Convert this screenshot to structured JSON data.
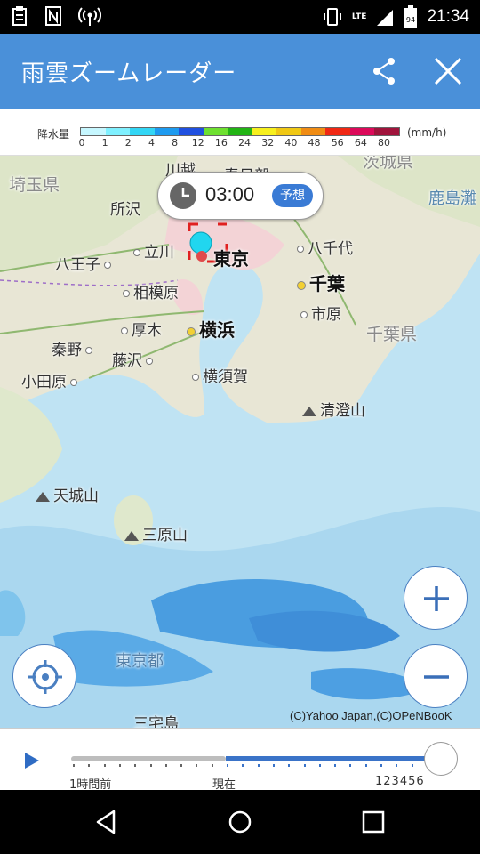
{
  "status_bar": {
    "time": "21:34",
    "network": "LTE",
    "battery": "94"
  },
  "app_bar": {
    "title": "雨雲ズームレーダー",
    "share_icon": "share-icon",
    "close_icon": "close-icon"
  },
  "legend": {
    "title": "降水量",
    "unit": "(mm/h)",
    "stops": [
      "0",
      "1",
      "2",
      "4",
      "8",
      "12",
      "16",
      "24",
      "32",
      "40",
      "48",
      "56",
      "64",
      "80"
    ],
    "colors": [
      "#c6f7ff",
      "#7ff0ff",
      "#33d6f5",
      "#1e9bf0",
      "#2050e0",
      "#6ee030",
      "#22b414",
      "#f7f01e",
      "#f0c814",
      "#f08c14",
      "#f02814",
      "#dc0a5a",
      "#a0143c"
    ]
  },
  "time_chip": {
    "time": "03:00",
    "badge": "予想"
  },
  "map": {
    "places": {
      "saitama": "埼玉県",
      "ibaraki": "茨城県",
      "kashimanada": "鹿島灘",
      "kawagoe": "川越",
      "kasukabe": "春日部",
      "tokorozawa": "所沢",
      "tachikawa": "立川",
      "hachioji": "八王子",
      "tokyo": "東京",
      "yachiyo": "八千代",
      "chiba": "千葉",
      "sagamihara": "相模原",
      "ichihara": "市原",
      "atsugi": "厚木",
      "yokohama": "横浜",
      "hadano": "秦野",
      "chibaken": "千葉県",
      "fujisawa": "藤沢",
      "odawara": "小田原",
      "yokosuka": "横須賀",
      "kiyosumi": "清澄山",
      "amagi": "天城山",
      "mihara": "三原山",
      "tokyoto": "東京都",
      "miyake": "三宅島"
    },
    "copyright": "(C)Yahoo Japan,(C)OPeNBooK"
  },
  "controls": {
    "locate_icon": "locate-icon",
    "zoom_in_icon": "plus-icon",
    "zoom_out_icon": "minus-icon"
  },
  "timeline": {
    "play_icon": "play-icon",
    "label_past": "1時間前",
    "label_now": "現在",
    "label_future": "123456",
    "position": 1.0
  },
  "nav_bar": {
    "back_icon": "back-icon",
    "home_icon": "home-icon",
    "recent_icon": "recent-apps-icon"
  },
  "colors": {
    "accent": "#4a90d9",
    "forecast_badge": "#3a7bd5",
    "timeline_future": "#3a73c8"
  }
}
